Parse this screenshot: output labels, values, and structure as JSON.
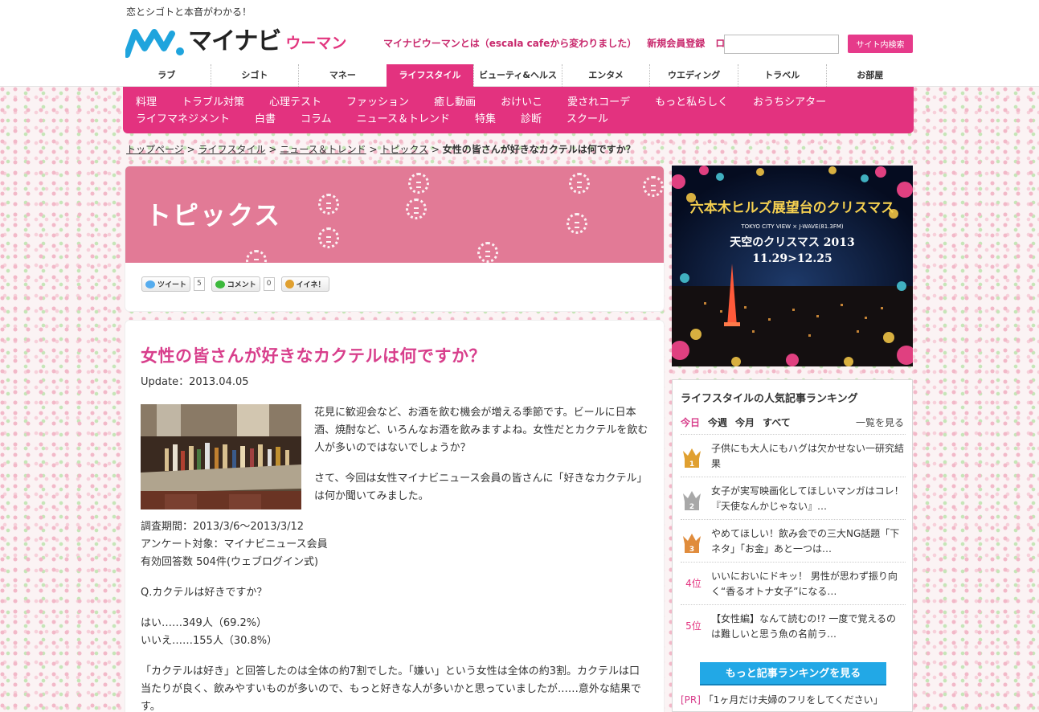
{
  "header": {
    "tagline": "恋とシゴトと本音がわかる！",
    "logo_main": "マイナビ",
    "logo_sub": "ウーマン",
    "links": [
      "マイナビウーマンとは（escala cafeから変わりました）",
      "新規会員登録",
      "ログイン"
    ],
    "search_placeholder": "",
    "search_button": "サイト内検索"
  },
  "global_nav": [
    {
      "label": "ラブ",
      "active": false
    },
    {
      "label": "シゴト",
      "active": false
    },
    {
      "label": "マネー",
      "active": false
    },
    {
      "label": "ライフスタイル",
      "active": true
    },
    {
      "label": "ビューティ&ヘルス",
      "active": false
    },
    {
      "label": "エンタメ",
      "active": false
    },
    {
      "label": "ウエディング",
      "active": false
    },
    {
      "label": "トラベル",
      "active": false
    },
    {
      "label": "お部屋",
      "active": false
    }
  ],
  "sub_nav": {
    "row1": [
      "料理",
      "トラブル対策",
      "心理テスト",
      "ファッション",
      "癒し動画",
      "おけいこ",
      "愛されコーデ",
      "もっと私らしく",
      "おうちシアター"
    ],
    "row2": [
      "ライフマネジメント",
      "白書",
      "コラム",
      "ニュース＆トレンド",
      "特集",
      "診断",
      "スクール"
    ]
  },
  "breadcrumb": {
    "links": [
      "トップページ",
      "ライフスタイル",
      "ニュース＆トレンド",
      "トピックス"
    ],
    "separator": ">",
    "current": "女性の皆さんが好きなカクテルは何ですか？"
  },
  "topics": {
    "title": "トピックス",
    "share": {
      "tweet_label": "ツイート",
      "tweet_count": "5",
      "comment_label": "コメント",
      "comment_count": "0",
      "iine_label": "イイネ！"
    }
  },
  "article": {
    "title": "女性の皆さんが好きなカクテルは何ですか？",
    "date": "Update：2013.04.05",
    "paragraphs": {
      "p1": "花見に歓迎会など、お酒を飲む機会が増える季節です。ビールに日本酒、焼酎など、いろんなお酒を飲みますよね。女性だとカクテルを飲む人が多いのではないでしょうか？",
      "p2": "さて、今回は女性マイナビニュース会員の皆さんに「好きなカクテル」は何か聞いてみました。",
      "survey_period": "調査期間：2013/3/6〜2013/3/12",
      "survey_target": "アンケート対象：マイナビニュース会員",
      "survey_count": "有効回答数 504件(ウェブログイン式)",
      "question": "Q.カクテルは好きですか？",
      "answer_yes": "はい……349人（69.2%）",
      "answer_no": "いいえ……155人（30.8%）",
      "p3": "「カクテルは好き」と回答したのは全体の約7割でした。「嫌い」という女性は全体の約3割。カクテルは口当たりが良く、飲みやすいものが多いので、もっと好きな人が多いかと思っていましたが……意外な結果です。"
    }
  },
  "banner": {
    "headline": "六本木ヒルズ展望台のクリスマス",
    "sub": "TOKYO CITY VIEW × J-WAVE(81.3FM)",
    "title": "天空のクリスマス 2013",
    "dates": "11.29>12.25"
  },
  "ranking": {
    "title": "ライフスタイルの人気記事ランキング",
    "tabs": [
      "今日",
      "今週",
      "今月",
      "すべて"
    ],
    "active_tab": "今日",
    "more_link": "一覧を見る",
    "items": [
      {
        "rank": "1",
        "text": "子供にも大人にもハグは欠かせない一研究結果"
      },
      {
        "rank": "2",
        "text": "女子が実写映画化してほしいマンガはコレ！『天使なんかじゃない』…"
      },
      {
        "rank": "3",
        "text": "やめてほしい！飲み会での三大NG話題「下ネタ」「お金」あと一つは…"
      },
      {
        "rank": "4位",
        "text": "いいにおいにドキッ！ 男性が思わず振り向く“香るオトナ女子”になる…"
      },
      {
        "rank": "5位",
        "text": "【女性編】なんて読むの!? 一度で覚えるのは難しいと思う魚の名前ラ…"
      }
    ],
    "more_button": "もっと記事ランキングを見る",
    "pr_tag": "[PR]",
    "pr_text": "「1ヶ月だけ夫婦のフリをしてください」"
  },
  "colors": {
    "accent": "#e3327f",
    "title_pink": "#d83f8c",
    "topics_bg": "#e27a96",
    "button_blue": "#22a8e6",
    "gold": "#e0a030",
    "silver": "#a8a8a8",
    "bronze": "#e08c3c"
  }
}
